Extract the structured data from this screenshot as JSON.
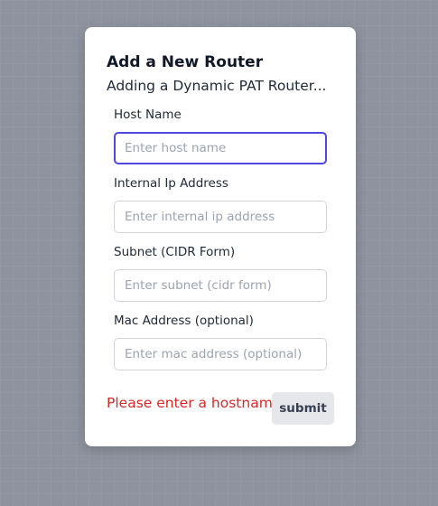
{
  "modal": {
    "title": "Add a New Router",
    "subtitle": "Adding a Dynamic PAT Router..."
  },
  "fields": [
    {
      "label": "Host Name",
      "placeholder": "Enter host name",
      "value": "",
      "focused": true
    },
    {
      "label": "Internal Ip Address",
      "placeholder": "Enter internal ip address",
      "value": ""
    },
    {
      "label": "Subnet (CIDR Form)",
      "placeholder": "Enter subnet (cidr form)",
      "value": ""
    },
    {
      "label": "Mac Address (optional)",
      "placeholder": "Enter mac address (optional)",
      "value": ""
    }
  ],
  "error_message": "Please enter a hostname",
  "submit_label": "submit",
  "colors": {
    "backdrop": "#8f939f",
    "focus_ring": "#4f46e5",
    "error": "#dc2626",
    "button_bg": "#e5e7eb"
  }
}
